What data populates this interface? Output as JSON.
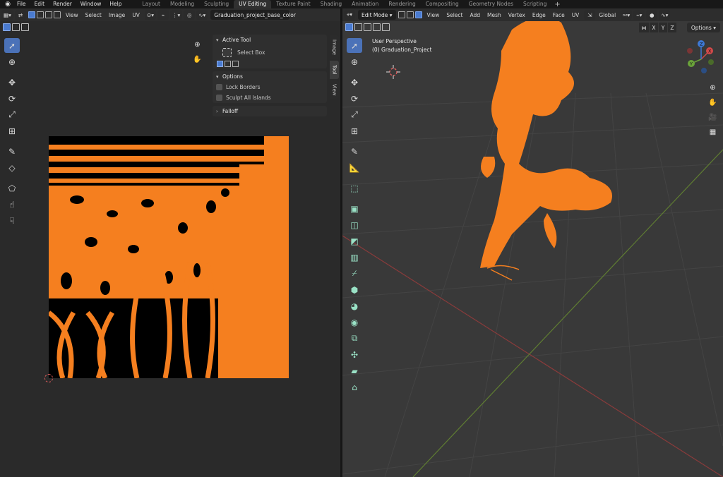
{
  "topbar": {
    "menus": [
      "File",
      "Edit",
      "Render",
      "Window",
      "Help"
    ],
    "workspaces": [
      "Layout",
      "Modeling",
      "Sculpting",
      "UV Editing",
      "Texture Paint",
      "Shading",
      "Animation",
      "Rendering",
      "Compositing",
      "Geometry Nodes",
      "Scripting"
    ],
    "active_workspace": "UV Editing",
    "add_label": "+"
  },
  "uv_editor": {
    "menus": [
      "View",
      "Select",
      "Image",
      "UV"
    ],
    "image_name": "Graduation_project_base_color",
    "sidebar": {
      "tabs": [
        "Image",
        "Tool",
        "View"
      ],
      "active_tab": "Tool",
      "active_tool_title": "Active Tool",
      "active_tool_name": "Select Box",
      "options_title": "Options",
      "lock_borders": "Lock Borders",
      "sculpt_all_islands": "Sculpt All Islands",
      "falloff_title": "Falloff"
    }
  },
  "viewport": {
    "mode": "Edit Mode",
    "menus": [
      "View",
      "Select",
      "Add",
      "Mesh",
      "Vertex",
      "Edge",
      "Face",
      "UV"
    ],
    "transform_orientation": "Global",
    "perspective_label": "User Perspective",
    "object_label": "(0) Graduation_Project",
    "options_label": "Options",
    "axis_buttons": [
      "X",
      "Y",
      "Z"
    ],
    "gizmo_axes": [
      "X",
      "Y",
      "Z"
    ]
  },
  "colors": {
    "accent": "#4b72b8",
    "uv_orange": "#f57f1f",
    "axis_x": "#d14a4a",
    "axis_y": "#6aa33a",
    "axis_z": "#3d79d6"
  }
}
